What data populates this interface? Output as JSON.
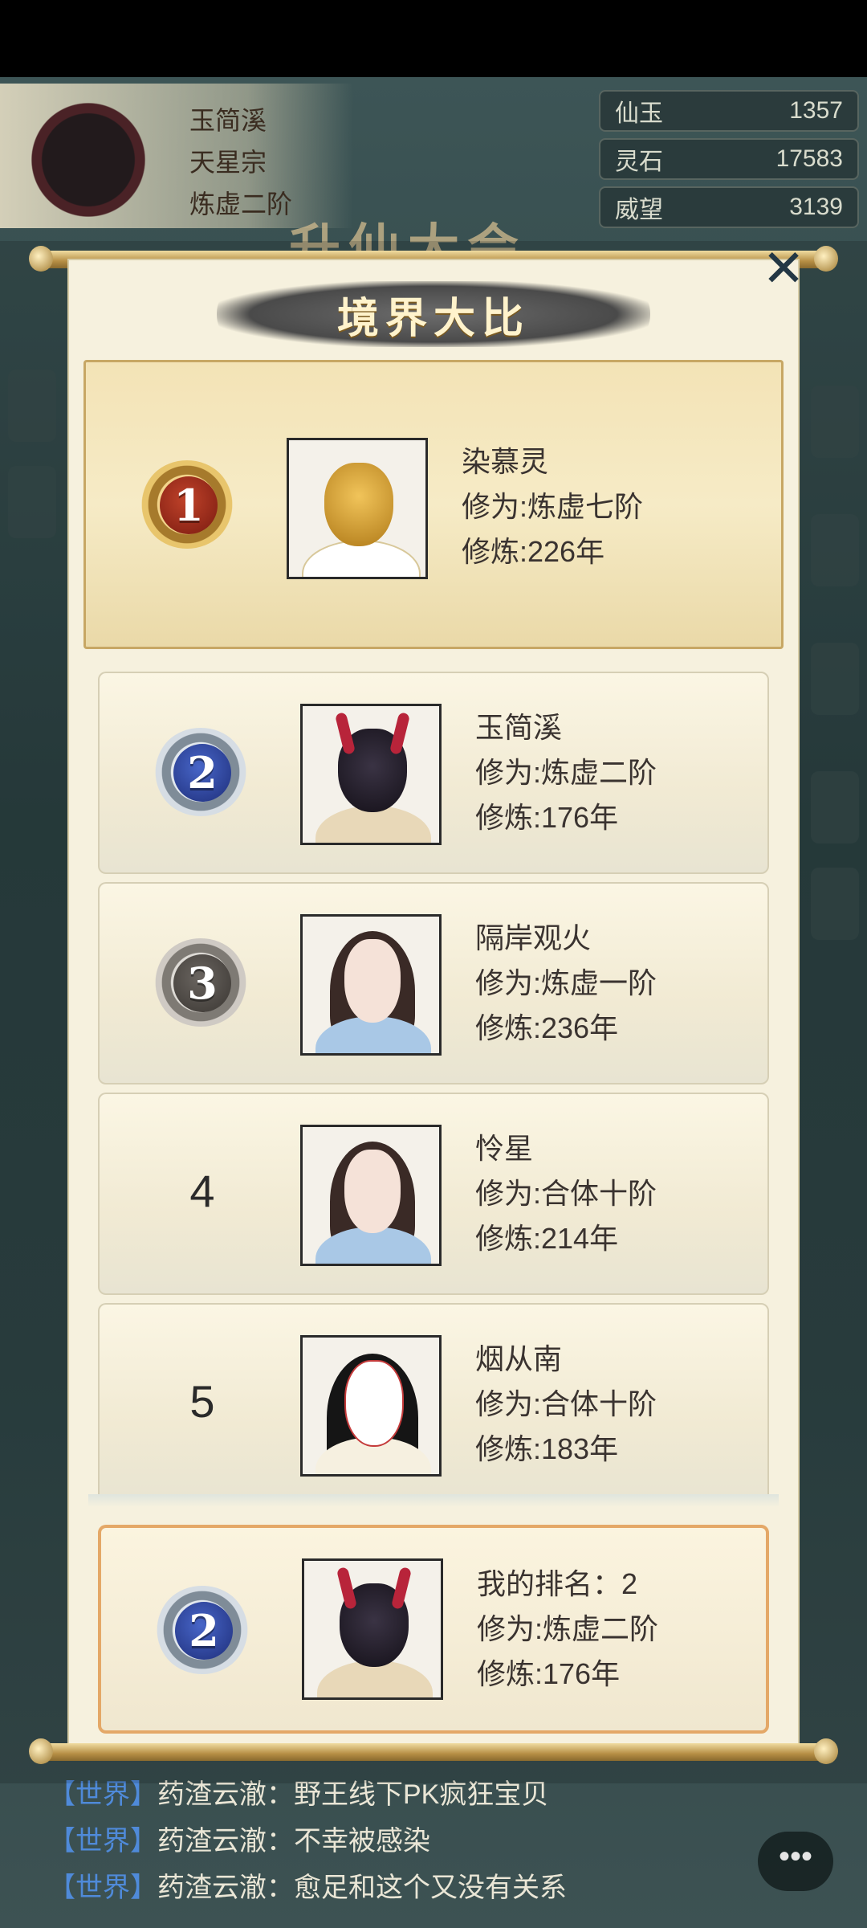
{
  "profile": {
    "name": "玉简溪",
    "sect": "天星宗",
    "realm": "炼虚二阶"
  },
  "resources": [
    {
      "label": "仙玉",
      "value": "1357"
    },
    {
      "label": "灵石",
      "value": "17583"
    },
    {
      "label": "威望",
      "value": "3139"
    }
  ],
  "background_title": "升仙大会",
  "modal": {
    "title": "境界大比",
    "close_glyph": "✕"
  },
  "rankings": [
    {
      "rank": "1",
      "name": "染慕灵",
      "cultivation": "修为:炼虚七阶",
      "years": "修炼:226年"
    },
    {
      "rank": "2",
      "name": "玉简溪",
      "cultivation": "修为:炼虚二阶",
      "years": "修炼:176年"
    },
    {
      "rank": "3",
      "name": "隔岸观火",
      "cultivation": "修为:炼虚一阶",
      "years": "修炼:236年"
    },
    {
      "rank": "4",
      "name": "怜星",
      "cultivation": "修为:合体十阶",
      "years": "修炼:214年"
    },
    {
      "rank": "5",
      "name": "烟从南",
      "cultivation": "修为:合体十阶",
      "years": "修炼:183年"
    }
  ],
  "my_rank": {
    "rank": "2",
    "label": "我的排名：2",
    "cultivation": "修为:炼虚二阶",
    "years": "修炼:176年"
  },
  "chat": [
    {
      "tag": "【世界】",
      "text": "药渣云澈：野王线下PK疯狂宝贝"
    },
    {
      "tag": "【世界】",
      "text": "药渣云澈：不幸被感染"
    },
    {
      "tag": "【世界】",
      "text": "药渣云澈：愈足和这个又没有关系"
    }
  ],
  "chat_button_glyph": "•••",
  "icons": [
    "close-icon",
    "chat-icon",
    "medal-gold-icon",
    "medal-silver-icon",
    "medal-bronze-icon"
  ]
}
